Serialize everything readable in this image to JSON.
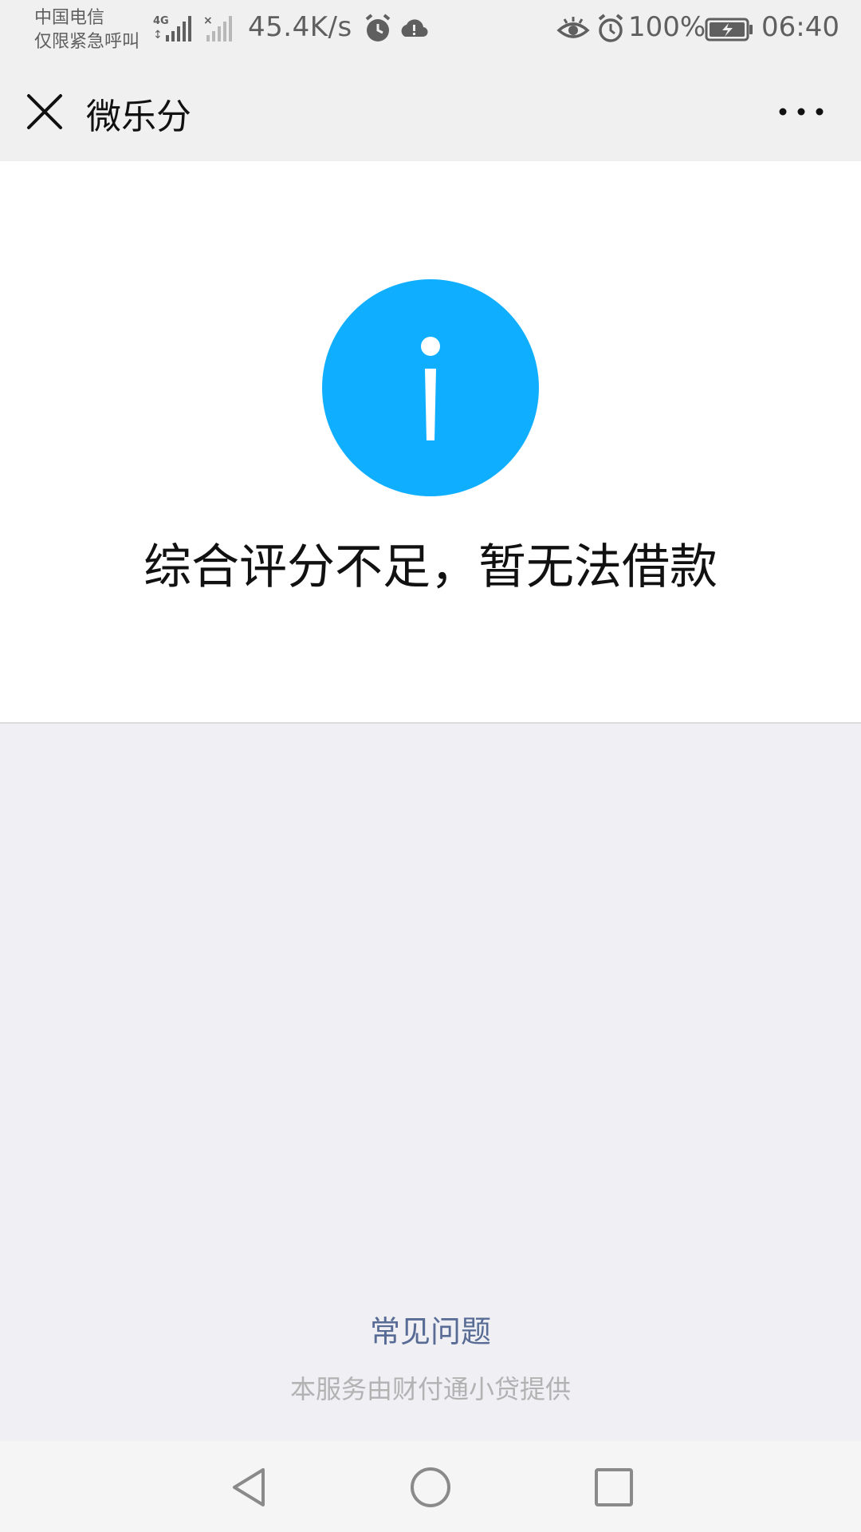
{
  "status_bar": {
    "carrier_line1": "中国电信",
    "carrier_line2": "仅限紧急呼叫",
    "network_type": "4G",
    "net_speed": "45.4K/s",
    "battery_percent": "100%",
    "time": "06:40",
    "icons": [
      "signal-4g-icon",
      "no-signal-icon",
      "alarm-icon",
      "cloud-alert-icon",
      "eye-icon",
      "alarm-icon",
      "battery-charging-icon"
    ]
  },
  "nav": {
    "title": "微乐分",
    "close_icon": "close-icon",
    "more_icon": "more-icon"
  },
  "result": {
    "icon": "info-icon",
    "icon_color": "#10aeff",
    "message": "综合评分不足，暂无法借款"
  },
  "footer": {
    "faq_link": "常见问题",
    "faq_color": "#576b95",
    "provider_note": "本服务由财付通小贷提供"
  },
  "system_nav": {
    "buttons": [
      "back-icon",
      "home-icon",
      "recents-icon"
    ]
  }
}
